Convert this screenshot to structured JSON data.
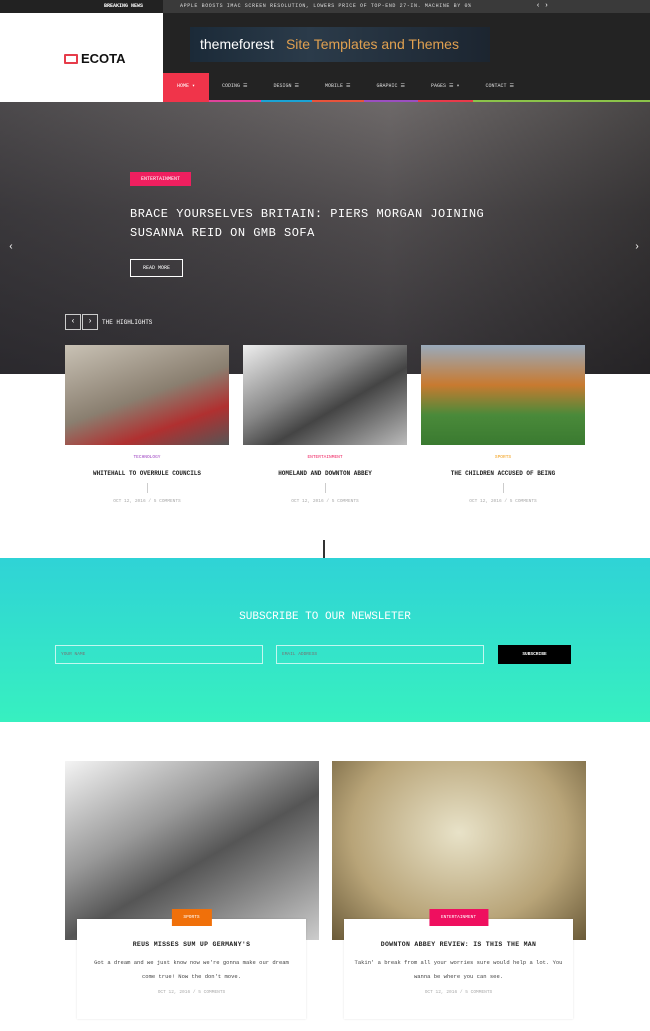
{
  "topbar": {
    "label": "BREAKING NEWS",
    "ticker": "APPLE BOOSTS IMAC SCREEN RESOLUTION, LOWERS PRICE OF TOP-END 27-IN. MACHINE BY 0%",
    "prev_icon": "chevron-left",
    "next_icon": "chevron-right"
  },
  "logo": {
    "text": "ECOTA"
  },
  "banner": {
    "brand": "themeforest",
    "slogan": "Site Templates and Themes"
  },
  "nav": [
    {
      "label": "HOME ▾",
      "color": "#f0344a",
      "active": true
    },
    {
      "label": "CODING ☰",
      "color": "#e0439a"
    },
    {
      "label": "DESIGN ☰",
      "color": "#1aa3d5"
    },
    {
      "label": "MOBILE ☰",
      "color": "#e8533b"
    },
    {
      "label": "GRAPHIC ☰",
      "color": "#9b4fc0"
    },
    {
      "label": "PAGES ☰ ▾",
      "color": "#e83a4a"
    },
    {
      "label": "CONTACT ☰",
      "color": "#8bc34a"
    }
  ],
  "hero": {
    "category": "ENTERTAINMENT",
    "title": "BRACE YOURSELVES BRITAIN: PIERS MORGAN JOINING SUSANNA REID ON GMB SOFA",
    "read_more": "READ MORE",
    "highlights": "THE HIGHLIGHTS"
  },
  "cards": [
    {
      "category": "TECHNOLOGY",
      "cat_color": "#9b3fc0",
      "title": "WHITEHALL TO OVERRULE COUNCILS",
      "meta": "OCT 12, 2016 / 5 COMMENTS"
    },
    {
      "category": "ENTERTAINMENT",
      "cat_color": "#ef1f5f",
      "title": "HOMELAND AND DOWNTON ABBEY",
      "meta": "OCT 12, 2016 / 5 COMMENTS"
    },
    {
      "category": "SPORTS",
      "cat_color": "#f39c12",
      "title": "THE CHILDREN ACCUSED OF BEING",
      "meta": "OCT 12, 2016 / 5 COMMENTS"
    }
  ],
  "newsletter": {
    "title": "SUBSCRIBE TO OUR NEWSLETER",
    "name_placeholder": "YOUR NAME",
    "email_placeholder": "EMAIL ADDRESS",
    "button": "SUBSCRIBE"
  },
  "posts": [
    {
      "category": "SPORTS",
      "color": "#f0700a",
      "title": "REUS MISSES SUM UP GERMANY'S",
      "excerpt": "Got a dream and we just know now we're gonna make our dream come true! Now the don't move.",
      "meta": "OCT 12, 2016 / 5 COMMENTS"
    },
    {
      "category": "ENTERTAINMENT",
      "color": "#ef0f5f",
      "title": "DOWNTON ABBEY REVIEW: IS THIS THE MAN",
      "excerpt": "Takin' a break from all your worries sure would help a lot. You wanna be where you can see.",
      "meta": "OCT 12, 2016 / 5 COMMENTS"
    }
  ]
}
